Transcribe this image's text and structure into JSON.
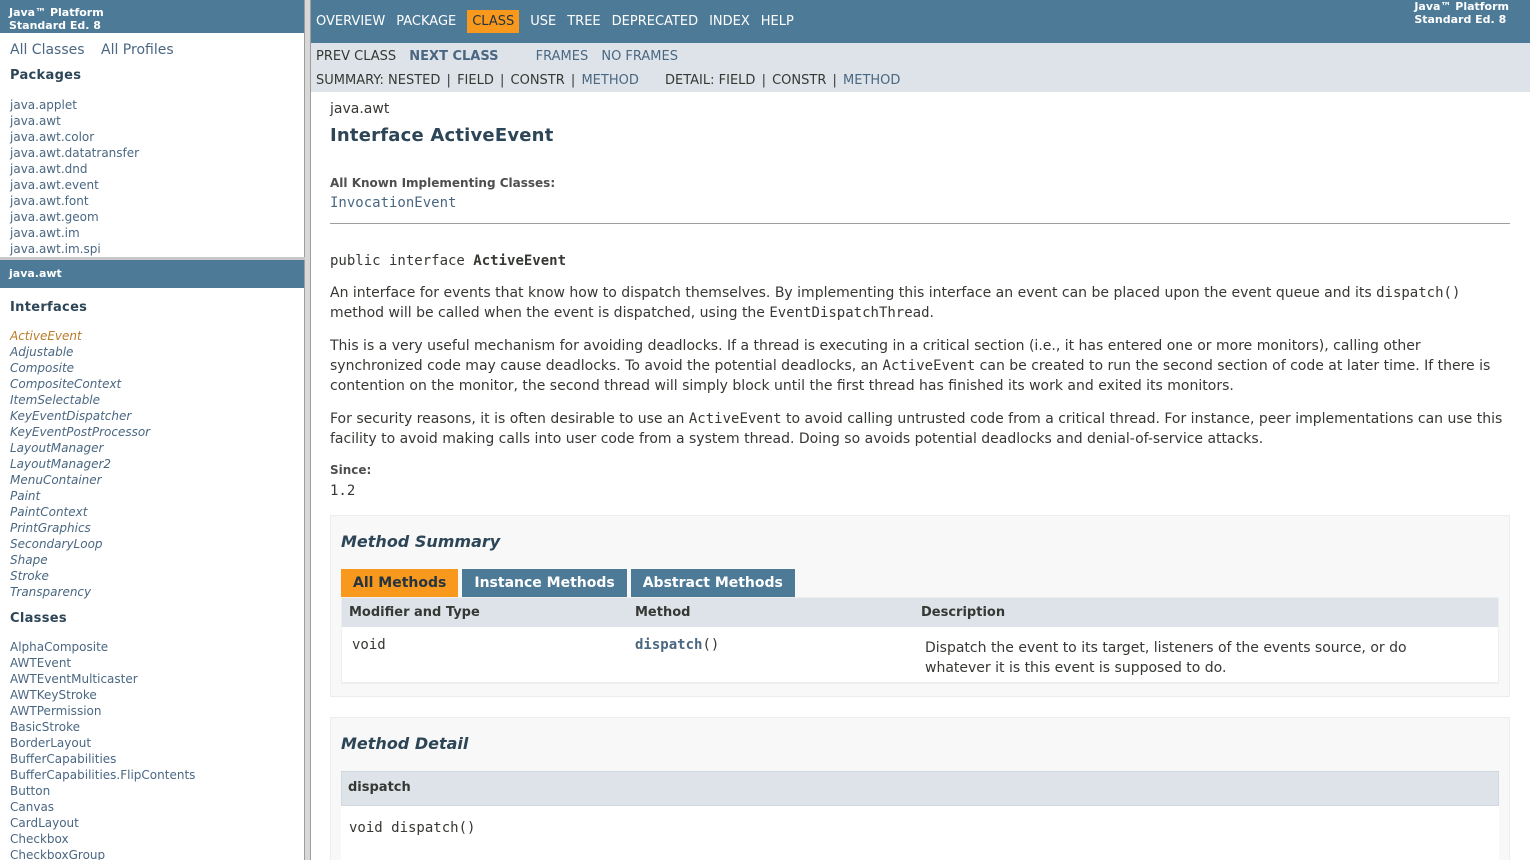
{
  "left_top": {
    "header": [
      "Java™ Platform",
      "Standard Ed. 8"
    ],
    "all_classes": "All Classes",
    "all_profiles": "All Profiles",
    "packages_heading": "Packages",
    "packages": [
      "java.applet",
      "java.awt",
      "java.awt.color",
      "java.awt.datatransfer",
      "java.awt.dnd",
      "java.awt.event",
      "java.awt.font",
      "java.awt.geom",
      "java.awt.im",
      "java.awt.im.spi"
    ]
  },
  "left_bottom": {
    "package_title": "java.awt",
    "interfaces_heading": "Interfaces",
    "interfaces": [
      "ActiveEvent",
      "Adjustable",
      "Composite",
      "CompositeContext",
      "ItemSelectable",
      "KeyEventDispatcher",
      "KeyEventPostProcessor",
      "LayoutManager",
      "LayoutManager2",
      "MenuContainer",
      "Paint",
      "PaintContext",
      "PrintGraphics",
      "SecondaryLoop",
      "Shape",
      "Stroke",
      "Transparency"
    ],
    "classes_heading": "Classes",
    "classes": [
      "AlphaComposite",
      "AWTEvent",
      "AWTEventMulticaster",
      "AWTKeyStroke",
      "AWTPermission",
      "BasicStroke",
      "BorderLayout",
      "BufferCapabilities",
      "BufferCapabilities.FlipContents",
      "Button",
      "Canvas",
      "CardLayout",
      "Checkbox",
      "CheckboxGroup"
    ]
  },
  "topnav": {
    "items": [
      "OVERVIEW",
      "PACKAGE",
      "CLASS",
      "USE",
      "TREE",
      "DEPRECATED",
      "INDEX",
      "HELP"
    ],
    "active": "CLASS",
    "about": [
      "Java™ Platform",
      "Standard Ed. 8"
    ]
  },
  "subnav": {
    "prev_class": "PREV CLASS",
    "next_class": "NEXT CLASS",
    "frames": "FRAMES",
    "no_frames": "NO FRAMES",
    "summary_label": "SUMMARY:",
    "summary_nested": "NESTED",
    "summary_field": "FIELD",
    "summary_constr": "CONSTR",
    "summary_method": "METHOD",
    "detail_label": "DETAIL:",
    "detail_field": "FIELD",
    "detail_constr": "CONSTR",
    "detail_method": "METHOD",
    "sep": "|"
  },
  "content": {
    "package": "java.awt",
    "title": "Interface ActiveEvent",
    "implementing_label": "All Known Implementing Classes:",
    "implementing_class": "InvocationEvent",
    "signature_prefix": "public interface ",
    "signature_name": "ActiveEvent",
    "p1_a": "An interface for events that know how to dispatch themselves. By implementing this interface an event can be placed upon the event queue and its ",
    "p1_code1": "dispatch()",
    "p1_b": " method will be called when the event is dispatched, using the ",
    "p1_code2": "EventDispatchThread",
    "p1_c": ".",
    "p2_a": "This is a very useful mechanism for avoiding deadlocks. If a thread is executing in a critical section (i.e., it has entered one or more monitors), calling other synchronized code may cause deadlocks. To avoid the potential deadlocks, an ",
    "p2_code": "ActiveEvent",
    "p2_b": " can be created to run the second section of code at later time. If there is contention on the monitor, the second thread will simply block until the first thread has finished its work and exited its monitors.",
    "p3_a": "For security reasons, it is often desirable to use an ",
    "p3_code": "ActiveEvent",
    "p3_b": " to avoid calling untrusted code from a critical thread. For instance, peer implementations can use this facility to avoid making calls into user code from a system thread. Doing so avoids potential deadlocks and denial-of-service attacks.",
    "since_label": "Since:",
    "since_value": "1.2"
  },
  "method_summary": {
    "title": "Method Summary",
    "tabs": [
      "All Methods",
      "Instance Methods",
      "Abstract Methods"
    ],
    "columns": [
      "Modifier and Type",
      "Method",
      "Description"
    ],
    "rows": [
      {
        "type": "void",
        "method_name": "dispatch",
        "method_params": "()",
        "description": "Dispatch the event to its target, listeners of the events source, or do whatever it is this event is supposed to do."
      }
    ]
  },
  "method_detail": {
    "title": "Method Detail",
    "name": "dispatch",
    "signature": "void dispatch()"
  },
  "colors": {
    "nav_blue": "#4d7a97",
    "active_orange": "#f8981d",
    "subnav_gray": "#dee3e9",
    "link": "#4a6782"
  }
}
